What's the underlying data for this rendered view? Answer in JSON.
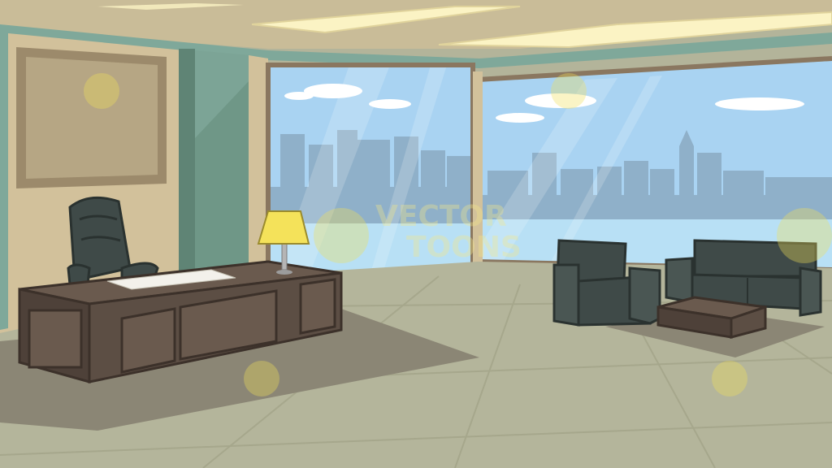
{
  "scene": {
    "description_free": true,
    "colors": {
      "ceiling": "#c9bc98",
      "ceiling_light": "#fbf3c4",
      "wall": "#d2c19b",
      "wall_trim": "#7fa89a",
      "pillar": "#6f9787",
      "floor": "#b4b59b",
      "floor_lines": "#a6a78c",
      "rug": "#8b8675",
      "sky": "#a9d3f2",
      "skyline": "#8fb0c9",
      "water": "#b8e0f5",
      "window_frame": "#8a7760",
      "desk": "#5c4e44",
      "desk_top": "#6a5a4e",
      "leather": "#3f4a48",
      "lamp_shade": "#f4e25a"
    },
    "watermark": {
      "line1": "VECTOR",
      "line2": "TOONS",
      "logo_icon": "vectortoons-mascot-icon"
    }
  }
}
